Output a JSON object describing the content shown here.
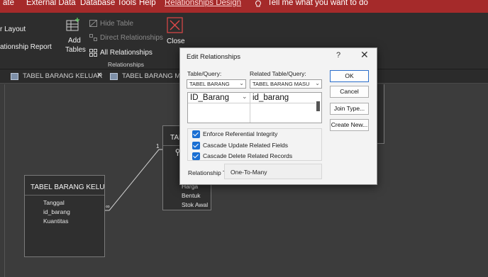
{
  "ribbon_tabs": [
    {
      "label": "ate"
    },
    {
      "label": "External Data"
    },
    {
      "label": "Database Tools"
    },
    {
      "label": "Help"
    },
    {
      "label": "Relationships Design"
    },
    {
      "label": "Tell me what you want to do"
    }
  ],
  "ribbon": {
    "layout_label": "r Layout",
    "report_label": "ationship Report",
    "add_tables_line1": "Add",
    "add_tables_line2": "Tables",
    "hide_table": "Hide Table",
    "direct_relationships": "Direct Relationships",
    "all_relationships": "All Relationships",
    "close": "Close",
    "group_label": "Relationships"
  },
  "doc_tabs": [
    {
      "label": "TABEL BARANG KELUAR"
    },
    {
      "label": "TABEL BARANG MASUK"
    }
  ],
  "canvas": {
    "table_keluar": {
      "title": "TABEL BARANG KELUAR",
      "fields": [
        "Tanggal",
        "id_barang",
        "Kuantitas"
      ]
    },
    "table_barang": {
      "title": "TAB",
      "fields": [
        "Harga",
        "Bentuk",
        "Stok Awal"
      ]
    }
  },
  "dialog": {
    "title": "Edit Relationships",
    "help": "?",
    "close": "✕",
    "table_query_label": "Table/Query:",
    "related_query_label": "Related Table/Query:",
    "table_query_value": "TABEL BARANG",
    "related_query_value": "TABEL BARANG MASU",
    "grid_left": "ID_Barang",
    "grid_right": "id_barang",
    "buttons": {
      "ok": "OK",
      "cancel": "Cancel",
      "join_type": "Join Type...",
      "create_new": "Create New..."
    },
    "checkboxes": [
      {
        "label": "Enforce Referential Integrity"
      },
      {
        "label": "Cascade Update Related Fields"
      },
      {
        "label": "Cascade Delete Related Records"
      }
    ],
    "relationship_type_label": "Relationship Type:",
    "relationship_type_value": "One-To-Many"
  }
}
